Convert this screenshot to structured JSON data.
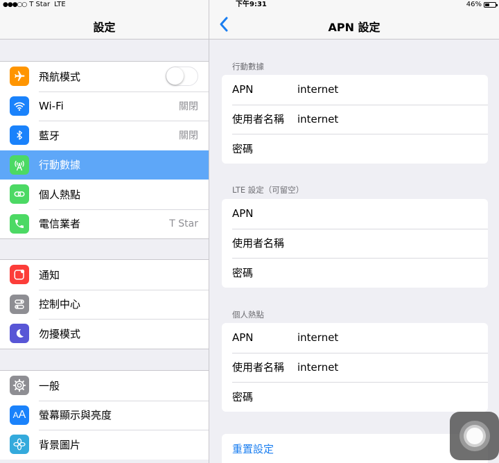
{
  "status_bar": {
    "signal": "●●●○○",
    "carrier": "T Star",
    "network": "LTE",
    "time": "下午9:31",
    "battery_percent": "46%",
    "battery_level": 0.46
  },
  "master": {
    "title": "設定",
    "groups": [
      {
        "items": [
          {
            "label": "飛航模式",
            "icon": "airplane-icon",
            "color": "#ff9500",
            "toggle": false
          },
          {
            "label": "Wi-Fi",
            "icon": "wifi-icon",
            "color": "#1a82fb",
            "value": "關閉"
          },
          {
            "label": "藍牙",
            "icon": "bluetooth-icon",
            "color": "#1a82fb",
            "value": "關閉"
          },
          {
            "label": "行動數據",
            "icon": "cellular-icon",
            "color": "#4cd964",
            "selected": true
          },
          {
            "label": "個人熱點",
            "icon": "hotspot-icon",
            "color": "#4cd964"
          },
          {
            "label": "電信業者",
            "icon": "phone-icon",
            "color": "#4cd964",
            "value": "T Star"
          }
        ]
      },
      {
        "items": [
          {
            "label": "通知",
            "icon": "notifications-icon",
            "color": "#fc3d39"
          },
          {
            "label": "控制中心",
            "icon": "control-center-icon",
            "color": "#8e8e93"
          },
          {
            "label": "勿擾模式",
            "icon": "moon-icon",
            "color": "#5856d6"
          }
        ]
      },
      {
        "items": [
          {
            "label": "一般",
            "icon": "gear-icon",
            "color": "#8e8e93"
          },
          {
            "label": "螢幕顯示與亮度",
            "icon": "display-icon",
            "color": "#1a82fb"
          },
          {
            "label": "背景圖片",
            "icon": "wallpaper-icon",
            "color": "#34aadc"
          }
        ]
      }
    ]
  },
  "detail": {
    "title": "APN 設定",
    "back_icon": "chevron-left-icon",
    "accent_color": "#1a7ef0",
    "sections": [
      {
        "header": "行動數據",
        "fields": [
          {
            "label": "APN",
            "value": "internet"
          },
          {
            "label": "使用者名稱",
            "value": "internet"
          },
          {
            "label": "密碼",
            "value": ""
          }
        ]
      },
      {
        "header": "LTE 設定（可留空）",
        "fields": [
          {
            "label": "APN",
            "value": ""
          },
          {
            "label": "使用者名稱",
            "value": ""
          },
          {
            "label": "密碼",
            "value": ""
          }
        ]
      },
      {
        "header": "個人熱點",
        "fields": [
          {
            "label": "APN",
            "value": "internet"
          },
          {
            "label": "使用者名稱",
            "value": "internet"
          },
          {
            "label": "密碼",
            "value": ""
          }
        ]
      }
    ],
    "reset_label": "重置設定"
  }
}
